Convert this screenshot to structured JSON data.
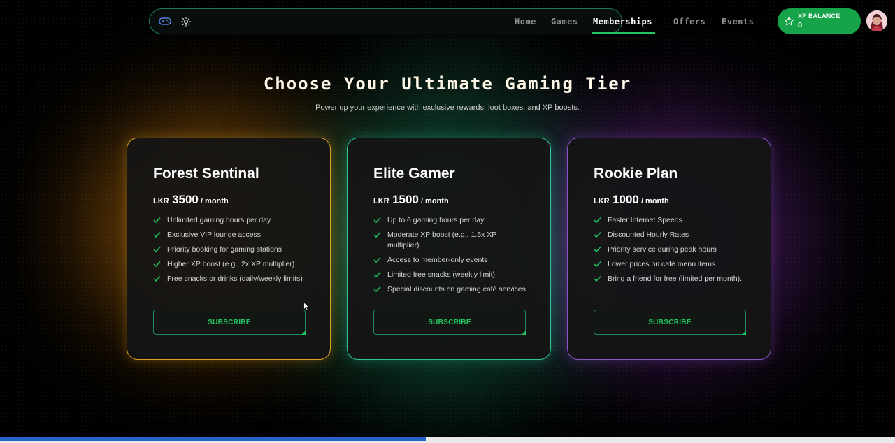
{
  "nav": {
    "links": [
      {
        "label": "Home"
      },
      {
        "label": "Games"
      },
      {
        "label": "Memberships"
      },
      {
        "label": "Offers"
      },
      {
        "label": "Events"
      }
    ],
    "active": "Memberships",
    "icons": [
      "gamepad-icon",
      "sun-icon"
    ]
  },
  "xp": {
    "label": "XP BALANCE",
    "value": "0"
  },
  "header": {
    "title": "Choose Your Ultimate Gaming Tier",
    "subtitle": "Power up your experience with exclusive rewards, loot boxes, and XP boosts."
  },
  "plans": [
    {
      "name": "Forest Sentinal",
      "currency": "LKR",
      "amount": "3500",
      "period": " / month",
      "features": [
        "Unlimited gaming hours per day",
        "Exclusive VIP lounge access",
        "Priority booking for gaming stations",
        "Higher XP boost (e.g., 2x XP multiplier)",
        "Free snacks or drinks (daily/weekly limits)"
      ],
      "button": "SUBSCRIBE",
      "accent": "#d9a126"
    },
    {
      "name": "Elite Gamer",
      "currency": "LKR",
      "amount": "1500",
      "period": " / month",
      "features": [
        "Up to 6 gaming hours per day",
        "Moderate XP boost (e.g., 1.5x XP multiplier)",
        "Access to member-only events",
        "Limited free snacks (weekly limit)",
        "Special discounts on gaming café services"
      ],
      "button": "SUBSCRIBE",
      "accent": "#2fc49a"
    },
    {
      "name": "Rookie Plan",
      "currency": "LKR",
      "amount": "1000",
      "period": " / month",
      "features": [
        "Faster Internet Speeds",
        "Discounted Hourly Rates",
        "Priority service during peak hours",
        "Lower prices on café menu items.",
        "Bring a friend for free (limited per month)."
      ],
      "button": "SUBSCRIBE",
      "accent": "#8b54c9"
    }
  ],
  "colors": {
    "brand_green": "#22c55e",
    "xp_badge": "#16a34a",
    "progress": "#2563c9"
  },
  "scroll_progress": 0.476
}
